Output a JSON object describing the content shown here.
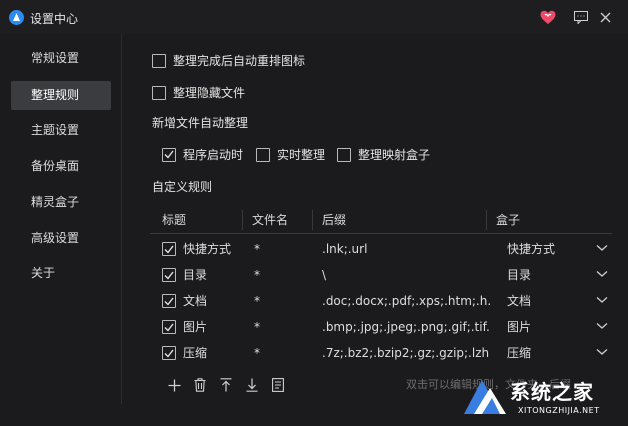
{
  "window": {
    "title": "设置中心"
  },
  "sidebar": {
    "items": [
      {
        "label": "常规设置",
        "active": false
      },
      {
        "label": "整理规则",
        "active": true
      },
      {
        "label": "主题设置",
        "active": false
      },
      {
        "label": "备份桌面",
        "active": false
      },
      {
        "label": "精灵盒子",
        "active": false
      },
      {
        "label": "高级设置",
        "active": false
      },
      {
        "label": "关于",
        "active": false
      }
    ]
  },
  "options": {
    "auto_arrange": {
      "label": "整理完成后自动重排图标",
      "checked": false
    },
    "hidden_files": {
      "label": "整理隐藏文件",
      "checked": false
    }
  },
  "new_files": {
    "title": "新增文件自动整理",
    "on_startup": {
      "label": "程序启动时",
      "checked": true
    },
    "realtime": {
      "label": "实时整理",
      "checked": false
    },
    "mapped_box": {
      "label": "整理映射盒子",
      "checked": false
    }
  },
  "custom_rules": {
    "title": "自定义规则",
    "columns": {
      "title": "标题",
      "filename": "文件名",
      "suffix": "后缀",
      "box": "盒子"
    },
    "rows": [
      {
        "title": "快捷方式",
        "filename": "*",
        "suffix": ".lnk;.url",
        "box": "快捷方式",
        "checked": true
      },
      {
        "title": "目录",
        "filename": "*",
        "suffix": "\\",
        "box": "目录",
        "checked": true
      },
      {
        "title": "文档",
        "filename": "*",
        "suffix": ".doc;.docx;.pdf;.xps;.htm;.h...",
        "box": "文档",
        "checked": true
      },
      {
        "title": "图片",
        "filename": "*",
        "suffix": ".bmp;.jpg;.jpeg;.png;.gif;.tif...",
        "box": "图片",
        "checked": true
      },
      {
        "title": "压缩",
        "filename": "*",
        "suffix": ".7z;.bz2;.bzip2;.gz;.gzip;.lzh...",
        "box": "压缩",
        "checked": true
      }
    ],
    "hint": "双击可以编辑规则，文件夹，后缀"
  },
  "watermark": {
    "brand": "系统之家",
    "url": "XITONGZHIJIA.NET"
  },
  "icons": {
    "app": "app-logo-icon",
    "heart": "heart-icon",
    "feedback": "feedback-icon",
    "close": "close-icon",
    "add": "add-icon",
    "delete": "trash-icon",
    "move_up": "move-up-icon",
    "move_down": "move-down-icon",
    "edit": "edit-icon"
  },
  "colors": {
    "accent_blue": "#2a8cf0",
    "heart": "#f04a6a",
    "background": "#1b1b1d",
    "active_item": "#3b3c40"
  }
}
